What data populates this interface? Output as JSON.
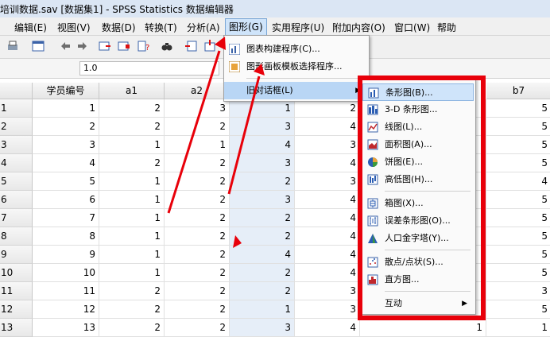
{
  "window": {
    "title": "培训数据.sav [数据集1] - SPSS Statistics 数据编辑器"
  },
  "menubar": [
    {
      "label": "编辑(E)",
      "x": 0
    },
    {
      "label": "视图(V)",
      "x": 1
    },
    {
      "label": "数据(D)",
      "x": 2
    },
    {
      "label": "转换(T)",
      "x": 3
    },
    {
      "label": "分析(A)",
      "x": 4
    },
    {
      "label": "图形(G)",
      "x": 5
    },
    {
      "label": "实用程序(U)",
      "x": 6
    },
    {
      "label": "附加内容(O)",
      "x": 7
    },
    {
      "label": "窗口(W)",
      "x": 8
    },
    {
      "label": "帮助",
      "x": 9
    }
  ],
  "cell_editor": {
    "value": "1.0"
  },
  "grid": {
    "headers": [
      "学员编号",
      "a1",
      "a2",
      "",
      "",
      "b7"
    ],
    "rows": [
      {
        "rn": "1",
        "vals": [
          "1",
          "2",
          "3",
          "1",
          "2",
          "",
          "5"
        ]
      },
      {
        "rn": "2",
        "vals": [
          "2",
          "2",
          "2",
          "3",
          "4",
          "",
          "5"
        ]
      },
      {
        "rn": "3",
        "vals": [
          "3",
          "1",
          "1",
          "4",
          "3",
          "",
          "5"
        ]
      },
      {
        "rn": "4",
        "vals": [
          "4",
          "2",
          "2",
          "3",
          "4",
          "",
          "5"
        ]
      },
      {
        "rn": "5",
        "vals": [
          "5",
          "1",
          "2",
          "2",
          "3",
          "",
          "4"
        ]
      },
      {
        "rn": "6",
        "vals": [
          "6",
          "1",
          "2",
          "3",
          "4",
          "",
          "5"
        ]
      },
      {
        "rn": "7",
        "vals": [
          "7",
          "1",
          "2",
          "2",
          "4",
          "",
          "5"
        ]
      },
      {
        "rn": "8",
        "vals": [
          "8",
          "1",
          "2",
          "2",
          "4",
          "",
          "5"
        ]
      },
      {
        "rn": "9",
        "vals": [
          "9",
          "1",
          "2",
          "4",
          "4",
          "",
          "5"
        ]
      },
      {
        "rn": "10",
        "vals": [
          "10",
          "1",
          "2",
          "2",
          "4",
          "",
          "5"
        ]
      },
      {
        "rn": "11",
        "vals": [
          "11",
          "2",
          "2",
          "2",
          "3",
          "",
          "3"
        ]
      },
      {
        "rn": "12",
        "vals": [
          "12",
          "2",
          "2",
          "1",
          "3",
          "",
          "5"
        ]
      },
      {
        "rn": "13",
        "vals": [
          "13",
          "2",
          "2",
          "3",
          "4",
          "1",
          "1"
        ]
      }
    ]
  },
  "graph_menu": {
    "items": [
      {
        "label": "图表构建程序(C)...",
        "icon": "chart-builder-icon"
      },
      {
        "label": "图形画板模板选择程序...",
        "icon": "graphboard-icon"
      },
      {
        "label": "旧对话框(L)",
        "icon": "",
        "submenu": true
      }
    ]
  },
  "legacy_menu": {
    "items": [
      {
        "label": "条形图(B)...",
        "icon": "bar-chart-icon",
        "highlight": true
      },
      {
        "label": "3-D 条形图...",
        "icon": "3d-bar-chart-icon"
      },
      {
        "label": "线图(L)...",
        "icon": "line-chart-icon"
      },
      {
        "label": "面积图(A)...",
        "icon": "area-chart-icon"
      },
      {
        "label": "饼图(E)...",
        "icon": "pie-chart-icon"
      },
      {
        "label": "高低图(H)...",
        "icon": "high-low-chart-icon"
      },
      {
        "sep": true
      },
      {
        "label": "箱图(X)...",
        "icon": "boxplot-icon"
      },
      {
        "label": "误差条形图(O)...",
        "icon": "error-bar-icon"
      },
      {
        "label": "人口金字塔(Y)...",
        "icon": "pyramid-icon"
      },
      {
        "sep": true
      },
      {
        "label": "散点/点状(S)...",
        "icon": "scatter-icon"
      },
      {
        "label": "直方图...",
        "icon": "histogram-icon"
      },
      {
        "sep": true
      },
      {
        "label": "互动",
        "icon": "",
        "submenu": true
      }
    ]
  },
  "colors": {
    "annotation": "#e8000a",
    "highlight": "#cfe4fa"
  }
}
